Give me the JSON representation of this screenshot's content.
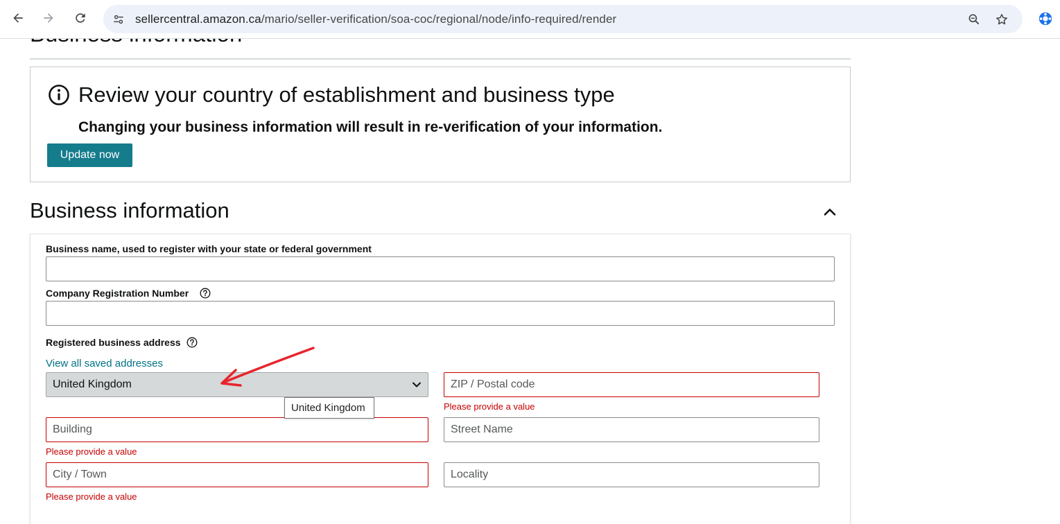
{
  "browser": {
    "url_host": "sellercentral.amazon.ca",
    "url_path": "/mario/seller-verification/soa-coc/regional/node/info-required/render",
    "back_icon": "arrow-left-icon",
    "forward_icon": "arrow-right-icon",
    "reload_icon": "reload-icon",
    "site_info_icon": "tune-icon",
    "zoom_icon": "zoom-icon",
    "bookmark_icon": "star-icon",
    "extension_icon": "extension-icon"
  },
  "page": {
    "top_heading": "Business information",
    "alert": {
      "icon": "info-icon",
      "title": "Review your country of establishment and business type",
      "subtitle": "Changing your business information will result in re-verification of your information.",
      "button": "Update now"
    },
    "section": {
      "title": "Business information",
      "collapse_icon": "chevron-up-icon"
    },
    "form": {
      "business_name_label": "Business name, used to register with your state or federal government",
      "business_name_value": "",
      "crn_label": "Company Registration Number",
      "crn_value": "",
      "address_label": "Registered business address",
      "saved_addresses_link": "View all saved addresses",
      "country_value": "United Kingdom",
      "country_tooltip": "United Kingdom",
      "zip_placeholder": "ZIP / Postal code",
      "zip_error": "Please provide a value",
      "building_placeholder": "Building",
      "building_error": "Please provide a value",
      "street_placeholder": "Street Name",
      "city_placeholder": "City / Town",
      "city_error": "Please provide a value",
      "locality_placeholder": "Locality"
    }
  },
  "colors": {
    "primary_button": "#157c8c",
    "link": "#007185",
    "error": "#c40000",
    "annotation_arrow": "#e8242c"
  }
}
